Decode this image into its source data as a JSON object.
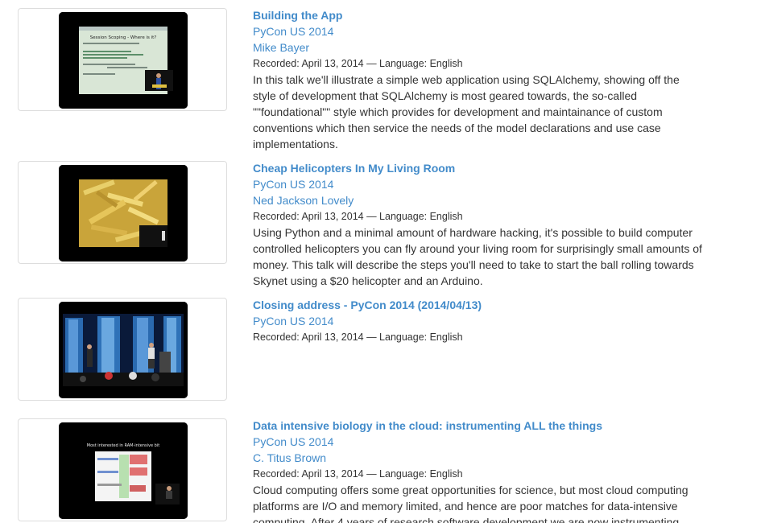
{
  "videos": [
    {
      "title": "Building the App",
      "event": "PyCon US 2014",
      "speaker": "Mike Bayer",
      "meta": "Recorded: April 13, 2014 — Language: English",
      "description": "In this talk we'll illustrate a simple web application using SQLAlchemy, showing off the style of development that SQLAlchemy is most geared towards, the so-called \"\"foundational\"\" style which provides for development and maintainance of custom conventions which then service the needs of the model declarations and use case implementations.",
      "thumb_text": "Session Scoping - Where is it?"
    },
    {
      "title": "Cheap Helicopters In My Living Room",
      "event": "PyCon US 2014",
      "speaker": "Ned Jackson Lovely",
      "meta": "Recorded: April 13, 2014 — Language: English",
      "description": "Using Python and a minimal amount of hardware hacking, it's possible to build computer controlled helicopters you can fly around your living room for surprisingly small amounts of money. This talk will describe the steps you'll need to take to start the ball rolling towards Skynet using a $20 helicopter and an Arduino."
    },
    {
      "title": "Closing address - PyCon 2014 (2014/04/13)",
      "event": "PyCon US 2014",
      "meta": "Recorded: April 13, 2014 — Language: English"
    },
    {
      "title": "Data intensive biology in the cloud: instrumenting ALL the things",
      "event": "PyCon US 2014",
      "speaker": "C. Titus Brown",
      "meta": "Recorded: April 13, 2014 — Language: English",
      "description": "Cloud computing offers some great opportunities for science, but most cloud computing platforms are I/O and memory limited, and hence are poor matches for data-intensive computing. After 4 years of research software development we are now instrumenting",
      "thumb_text": "Most interested in RAM-intensive bit"
    }
  ]
}
